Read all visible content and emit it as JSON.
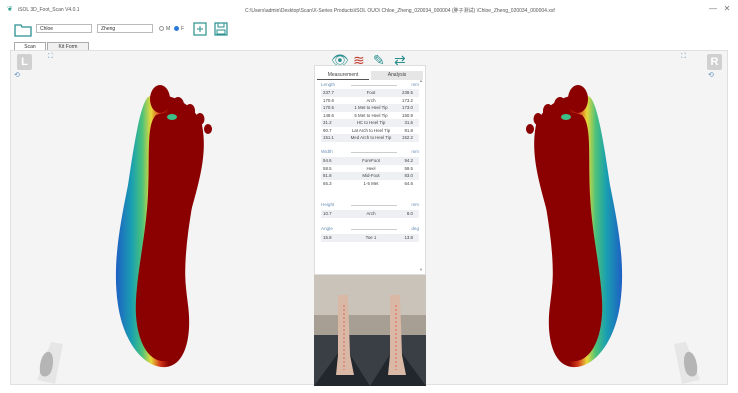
{
  "window": {
    "app_title": "iSOL 3D_Foot_Scan V4.0.1",
    "path_title": "C:\\Users\\admin\\Desktop\\Scan\\X-Series Products\\iSOL OUO\\ Chloe_Zheng_020034_000004 (胖子测试) \\Chloe_Zheng_020034_000004.xsf",
    "min_label": "—",
    "close_label": "✕"
  },
  "toolbar": {
    "first_name": "Chloe",
    "last_name": "Zheng",
    "gender_m": "M",
    "gender_f": "F",
    "gender_selected": "F"
  },
  "tabs": [
    {
      "label": "Scan"
    },
    {
      "label": "Kit Form"
    }
  ],
  "side": {
    "left_label": "L",
    "right_label": "R"
  },
  "panel": {
    "tabs": [
      {
        "label": "Measurement"
      },
      {
        "label": "Analysis"
      }
    ],
    "length": {
      "title": "Length",
      "unit": "mm",
      "rows": [
        {
          "left": "237.7",
          "name": "Foot",
          "right": "239.5"
        },
        {
          "left": "170.6",
          "name": "Arch",
          "right": "173.2"
        },
        {
          "left": "170.5",
          "name": "1 Met to Heel Tip",
          "right": "173.0"
        },
        {
          "left": "149.6",
          "name": "5 Met to Heel Tip",
          "right": "150.9"
        },
        {
          "left": "31.2",
          "name": "HC to Heel Tip",
          "right": "31.6"
        },
        {
          "left": "90.7",
          "name": "Lat Arch to Heel Tip",
          "right": "91.8"
        },
        {
          "left": "151.1",
          "name": "Med Arch to Heel Tip",
          "right": "152.2"
        }
      ]
    },
    "width": {
      "title": "Width",
      "unit": "mm",
      "rows": [
        {
          "left": "94.6",
          "name": "ForeFoot",
          "right": "94.2"
        },
        {
          "left": "58.5",
          "name": "Heel",
          "right": "59.5"
        },
        {
          "left": "81.8",
          "name": "Mid-Foot",
          "right": "83.0"
        },
        {
          "left": "65.3",
          "name": "1-5 Met",
          "right": "64.6"
        }
      ]
    },
    "height": {
      "title": "Height",
      "unit": "mm",
      "rows": [
        {
          "left": "10.7",
          "name": "Arch",
          "right": "8.0"
        }
      ]
    },
    "angle": {
      "title": "Angle",
      "unit": "deg",
      "rows": [
        {
          "left": "15.8",
          "name": "Toe 1",
          "right": "13.8"
        }
      ]
    }
  },
  "colors": {
    "accent": "#2b7bd6",
    "heatmap_high": "#8b0000",
    "heatmap_low": "#1e5fc4"
  }
}
